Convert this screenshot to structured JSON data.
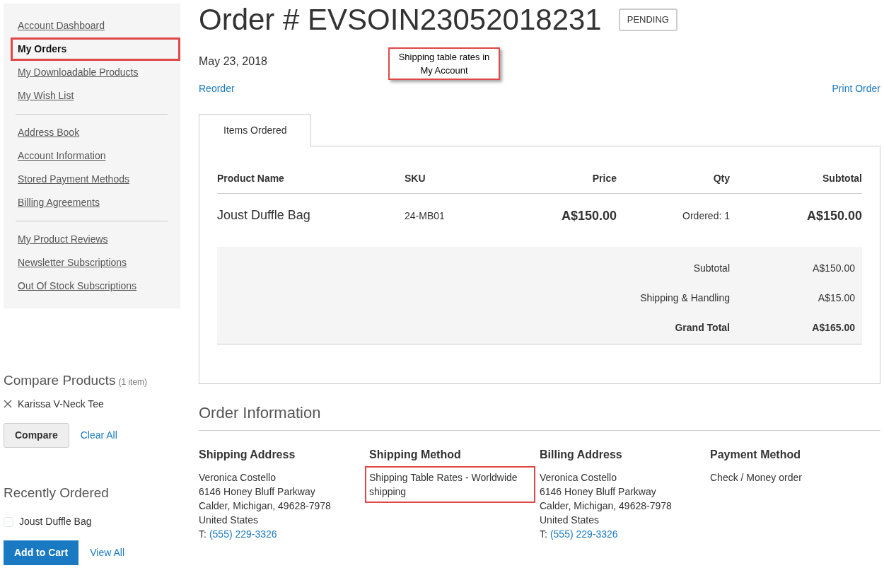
{
  "sidebar": {
    "groups": [
      [
        {
          "label": "Account Dashboard",
          "selected": false,
          "highlighted": false
        },
        {
          "label": "My Orders",
          "selected": true,
          "highlighted": true
        },
        {
          "label": "My Downloadable Products",
          "selected": false,
          "highlighted": false
        },
        {
          "label": "My Wish List",
          "selected": false,
          "highlighted": false
        }
      ],
      [
        {
          "label": "Address Book",
          "selected": false,
          "highlighted": false
        },
        {
          "label": "Account Information",
          "selected": false,
          "highlighted": false
        },
        {
          "label": "Stored Payment Methods",
          "selected": false,
          "highlighted": false
        },
        {
          "label": "Billing Agreements",
          "selected": false,
          "highlighted": false
        }
      ],
      [
        {
          "label": "My Product Reviews",
          "selected": false,
          "highlighted": false
        },
        {
          "label": "Newsletter Subscriptions",
          "selected": false,
          "highlighted": false
        },
        {
          "label": "Out Of Stock Subscriptions",
          "selected": false,
          "highlighted": false
        }
      ]
    ]
  },
  "compare": {
    "title": "Compare Products",
    "count": "(1 item)",
    "items": [
      "Karissa V-Neck Tee"
    ],
    "button": "Compare",
    "clear": "Clear All"
  },
  "recently_ordered": {
    "title": "Recently Ordered",
    "items": [
      {
        "label": "Joust Duffle Bag",
        "checked": false
      }
    ],
    "button": "Add to Cart",
    "view_all": "View All"
  },
  "order": {
    "title": "Order # EVSOIN23052018231",
    "status": "PENDING",
    "date": "May 23, 2018",
    "reorder": "Reorder",
    "print": "Print Order"
  },
  "callout": "Shipping table rates in My Account",
  "tabs": [
    {
      "label": "Items Ordered",
      "selected": true
    }
  ],
  "table": {
    "columns": [
      "Product Name",
      "SKU",
      "Price",
      "Qty",
      "Subtotal"
    ],
    "rows": [
      {
        "name": "Joust Duffle Bag",
        "sku": "24-MB01",
        "price": "A$150.00",
        "qty": "Ordered: 1",
        "subtotal": "A$150.00"
      }
    ],
    "totals": [
      {
        "label": "Subtotal",
        "value": "A$150.00",
        "kind": "normal"
      },
      {
        "label": "Shipping & Handling",
        "value": "A$15.00",
        "kind": "normal"
      },
      {
        "label": "Grand Total",
        "value": "A$165.00",
        "kind": "grand"
      }
    ]
  },
  "order_information": {
    "title": "Order Information",
    "blocks": [
      {
        "title": "Shipping Address",
        "lines": [
          "Veronica Costello",
          "6146 Honey Bluff Parkway",
          "Calder, Michigan, 49628-7978",
          "United States"
        ],
        "phone_label": "T:",
        "phone": "(555) 229-3326",
        "highlighted": false
      },
      {
        "title": "Shipping Method",
        "lines": [
          "Shipping Table Rates - Worldwide shipping"
        ],
        "highlighted": true
      },
      {
        "title": "Billing Address",
        "lines": [
          "Veronica Costello",
          "6146 Honey Bluff Parkway",
          "Calder, Michigan, 49628-7978",
          "United States"
        ],
        "phone_label": "T:",
        "phone": "(555) 229-3326",
        "highlighted": false
      },
      {
        "title": "Payment Method",
        "lines": [
          "Check / Money order"
        ],
        "highlighted": false
      }
    ]
  }
}
